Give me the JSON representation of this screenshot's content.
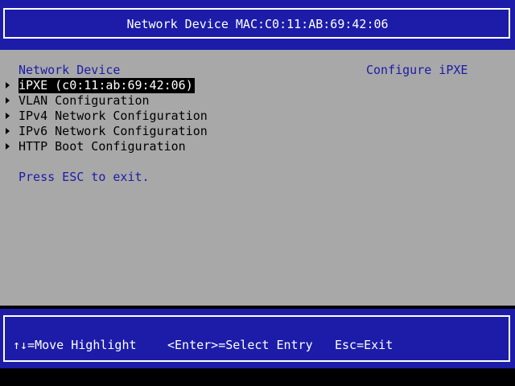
{
  "header": {
    "title": "Network Device MAC:C0:11:AB:69:42:06"
  },
  "main": {
    "section_title": "Network Device",
    "help_text": "Configure iPXE",
    "menu_items": [
      {
        "label": "iPXE (c0:11:ab:69:42:06)",
        "selected": true
      },
      {
        "label": "VLAN Configuration",
        "selected": false
      },
      {
        "label": "IPv4 Network Configuration",
        "selected": false
      },
      {
        "label": "IPv6 Network Configuration",
        "selected": false
      },
      {
        "label": "HTTP Boot Configuration",
        "selected": false
      }
    ],
    "exit_hint": "Press ESC to exit."
  },
  "footer": {
    "move_hint": "↑↓=Move Highlight",
    "select_hint": "<Enter>=Select Entry",
    "exit_hint": "Esc=Exit"
  },
  "colors": {
    "bios_blue": "#1c1ca8",
    "panel_gray": "#a8a8a8",
    "highlight_bg": "#000000",
    "highlight_fg": "#ffffff"
  }
}
